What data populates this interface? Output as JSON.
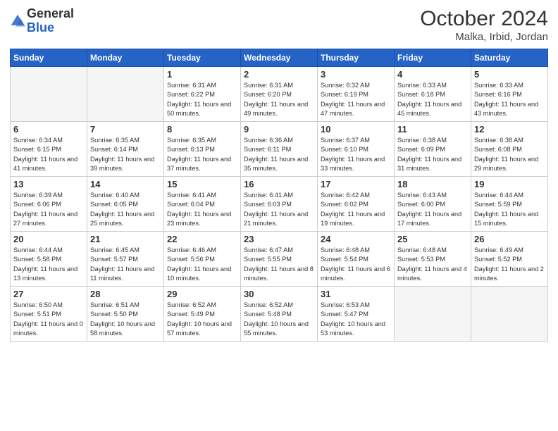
{
  "logo": {
    "general": "General",
    "blue": "Blue"
  },
  "title": "October 2024",
  "location": "Malka, Irbid, Jordan",
  "days_of_week": [
    "Sunday",
    "Monday",
    "Tuesday",
    "Wednesday",
    "Thursday",
    "Friday",
    "Saturday"
  ],
  "weeks": [
    [
      {
        "day": "",
        "info": ""
      },
      {
        "day": "",
        "info": ""
      },
      {
        "day": "1",
        "info": "Sunrise: 6:31 AM\nSunset: 6:22 PM\nDaylight: 11 hours and 50 minutes."
      },
      {
        "day": "2",
        "info": "Sunrise: 6:31 AM\nSunset: 6:20 PM\nDaylight: 11 hours and 49 minutes."
      },
      {
        "day": "3",
        "info": "Sunrise: 6:32 AM\nSunset: 6:19 PM\nDaylight: 11 hours and 47 minutes."
      },
      {
        "day": "4",
        "info": "Sunrise: 6:33 AM\nSunset: 6:18 PM\nDaylight: 11 hours and 45 minutes."
      },
      {
        "day": "5",
        "info": "Sunrise: 6:33 AM\nSunset: 6:16 PM\nDaylight: 11 hours and 43 minutes."
      }
    ],
    [
      {
        "day": "6",
        "info": "Sunrise: 6:34 AM\nSunset: 6:15 PM\nDaylight: 11 hours and 41 minutes."
      },
      {
        "day": "7",
        "info": "Sunrise: 6:35 AM\nSunset: 6:14 PM\nDaylight: 11 hours and 39 minutes."
      },
      {
        "day": "8",
        "info": "Sunrise: 6:35 AM\nSunset: 6:13 PM\nDaylight: 11 hours and 37 minutes."
      },
      {
        "day": "9",
        "info": "Sunrise: 6:36 AM\nSunset: 6:11 PM\nDaylight: 11 hours and 35 minutes."
      },
      {
        "day": "10",
        "info": "Sunrise: 6:37 AM\nSunset: 6:10 PM\nDaylight: 11 hours and 33 minutes."
      },
      {
        "day": "11",
        "info": "Sunrise: 6:38 AM\nSunset: 6:09 PM\nDaylight: 11 hours and 31 minutes."
      },
      {
        "day": "12",
        "info": "Sunrise: 6:38 AM\nSunset: 6:08 PM\nDaylight: 11 hours and 29 minutes."
      }
    ],
    [
      {
        "day": "13",
        "info": "Sunrise: 6:39 AM\nSunset: 6:06 PM\nDaylight: 11 hours and 27 minutes."
      },
      {
        "day": "14",
        "info": "Sunrise: 6:40 AM\nSunset: 6:05 PM\nDaylight: 11 hours and 25 minutes."
      },
      {
        "day": "15",
        "info": "Sunrise: 6:41 AM\nSunset: 6:04 PM\nDaylight: 11 hours and 23 minutes."
      },
      {
        "day": "16",
        "info": "Sunrise: 6:41 AM\nSunset: 6:03 PM\nDaylight: 11 hours and 21 minutes."
      },
      {
        "day": "17",
        "info": "Sunrise: 6:42 AM\nSunset: 6:02 PM\nDaylight: 11 hours and 19 minutes."
      },
      {
        "day": "18",
        "info": "Sunrise: 6:43 AM\nSunset: 6:00 PM\nDaylight: 11 hours and 17 minutes."
      },
      {
        "day": "19",
        "info": "Sunrise: 6:44 AM\nSunset: 5:59 PM\nDaylight: 11 hours and 15 minutes."
      }
    ],
    [
      {
        "day": "20",
        "info": "Sunrise: 6:44 AM\nSunset: 5:58 PM\nDaylight: 11 hours and 13 minutes."
      },
      {
        "day": "21",
        "info": "Sunrise: 6:45 AM\nSunset: 5:57 PM\nDaylight: 11 hours and 11 minutes."
      },
      {
        "day": "22",
        "info": "Sunrise: 6:46 AM\nSunset: 5:56 PM\nDaylight: 11 hours and 10 minutes."
      },
      {
        "day": "23",
        "info": "Sunrise: 6:47 AM\nSunset: 5:55 PM\nDaylight: 11 hours and 8 minutes."
      },
      {
        "day": "24",
        "info": "Sunrise: 6:48 AM\nSunset: 5:54 PM\nDaylight: 11 hours and 6 minutes."
      },
      {
        "day": "25",
        "info": "Sunrise: 6:48 AM\nSunset: 5:53 PM\nDaylight: 11 hours and 4 minutes."
      },
      {
        "day": "26",
        "info": "Sunrise: 6:49 AM\nSunset: 5:52 PM\nDaylight: 11 hours and 2 minutes."
      }
    ],
    [
      {
        "day": "27",
        "info": "Sunrise: 6:50 AM\nSunset: 5:51 PM\nDaylight: 11 hours and 0 minutes."
      },
      {
        "day": "28",
        "info": "Sunrise: 6:51 AM\nSunset: 5:50 PM\nDaylight: 10 hours and 58 minutes."
      },
      {
        "day": "29",
        "info": "Sunrise: 6:52 AM\nSunset: 5:49 PM\nDaylight: 10 hours and 57 minutes."
      },
      {
        "day": "30",
        "info": "Sunrise: 6:52 AM\nSunset: 5:48 PM\nDaylight: 10 hours and 55 minutes."
      },
      {
        "day": "31",
        "info": "Sunrise: 6:53 AM\nSunset: 5:47 PM\nDaylight: 10 hours and 53 minutes."
      },
      {
        "day": "",
        "info": ""
      },
      {
        "day": "",
        "info": ""
      }
    ]
  ]
}
